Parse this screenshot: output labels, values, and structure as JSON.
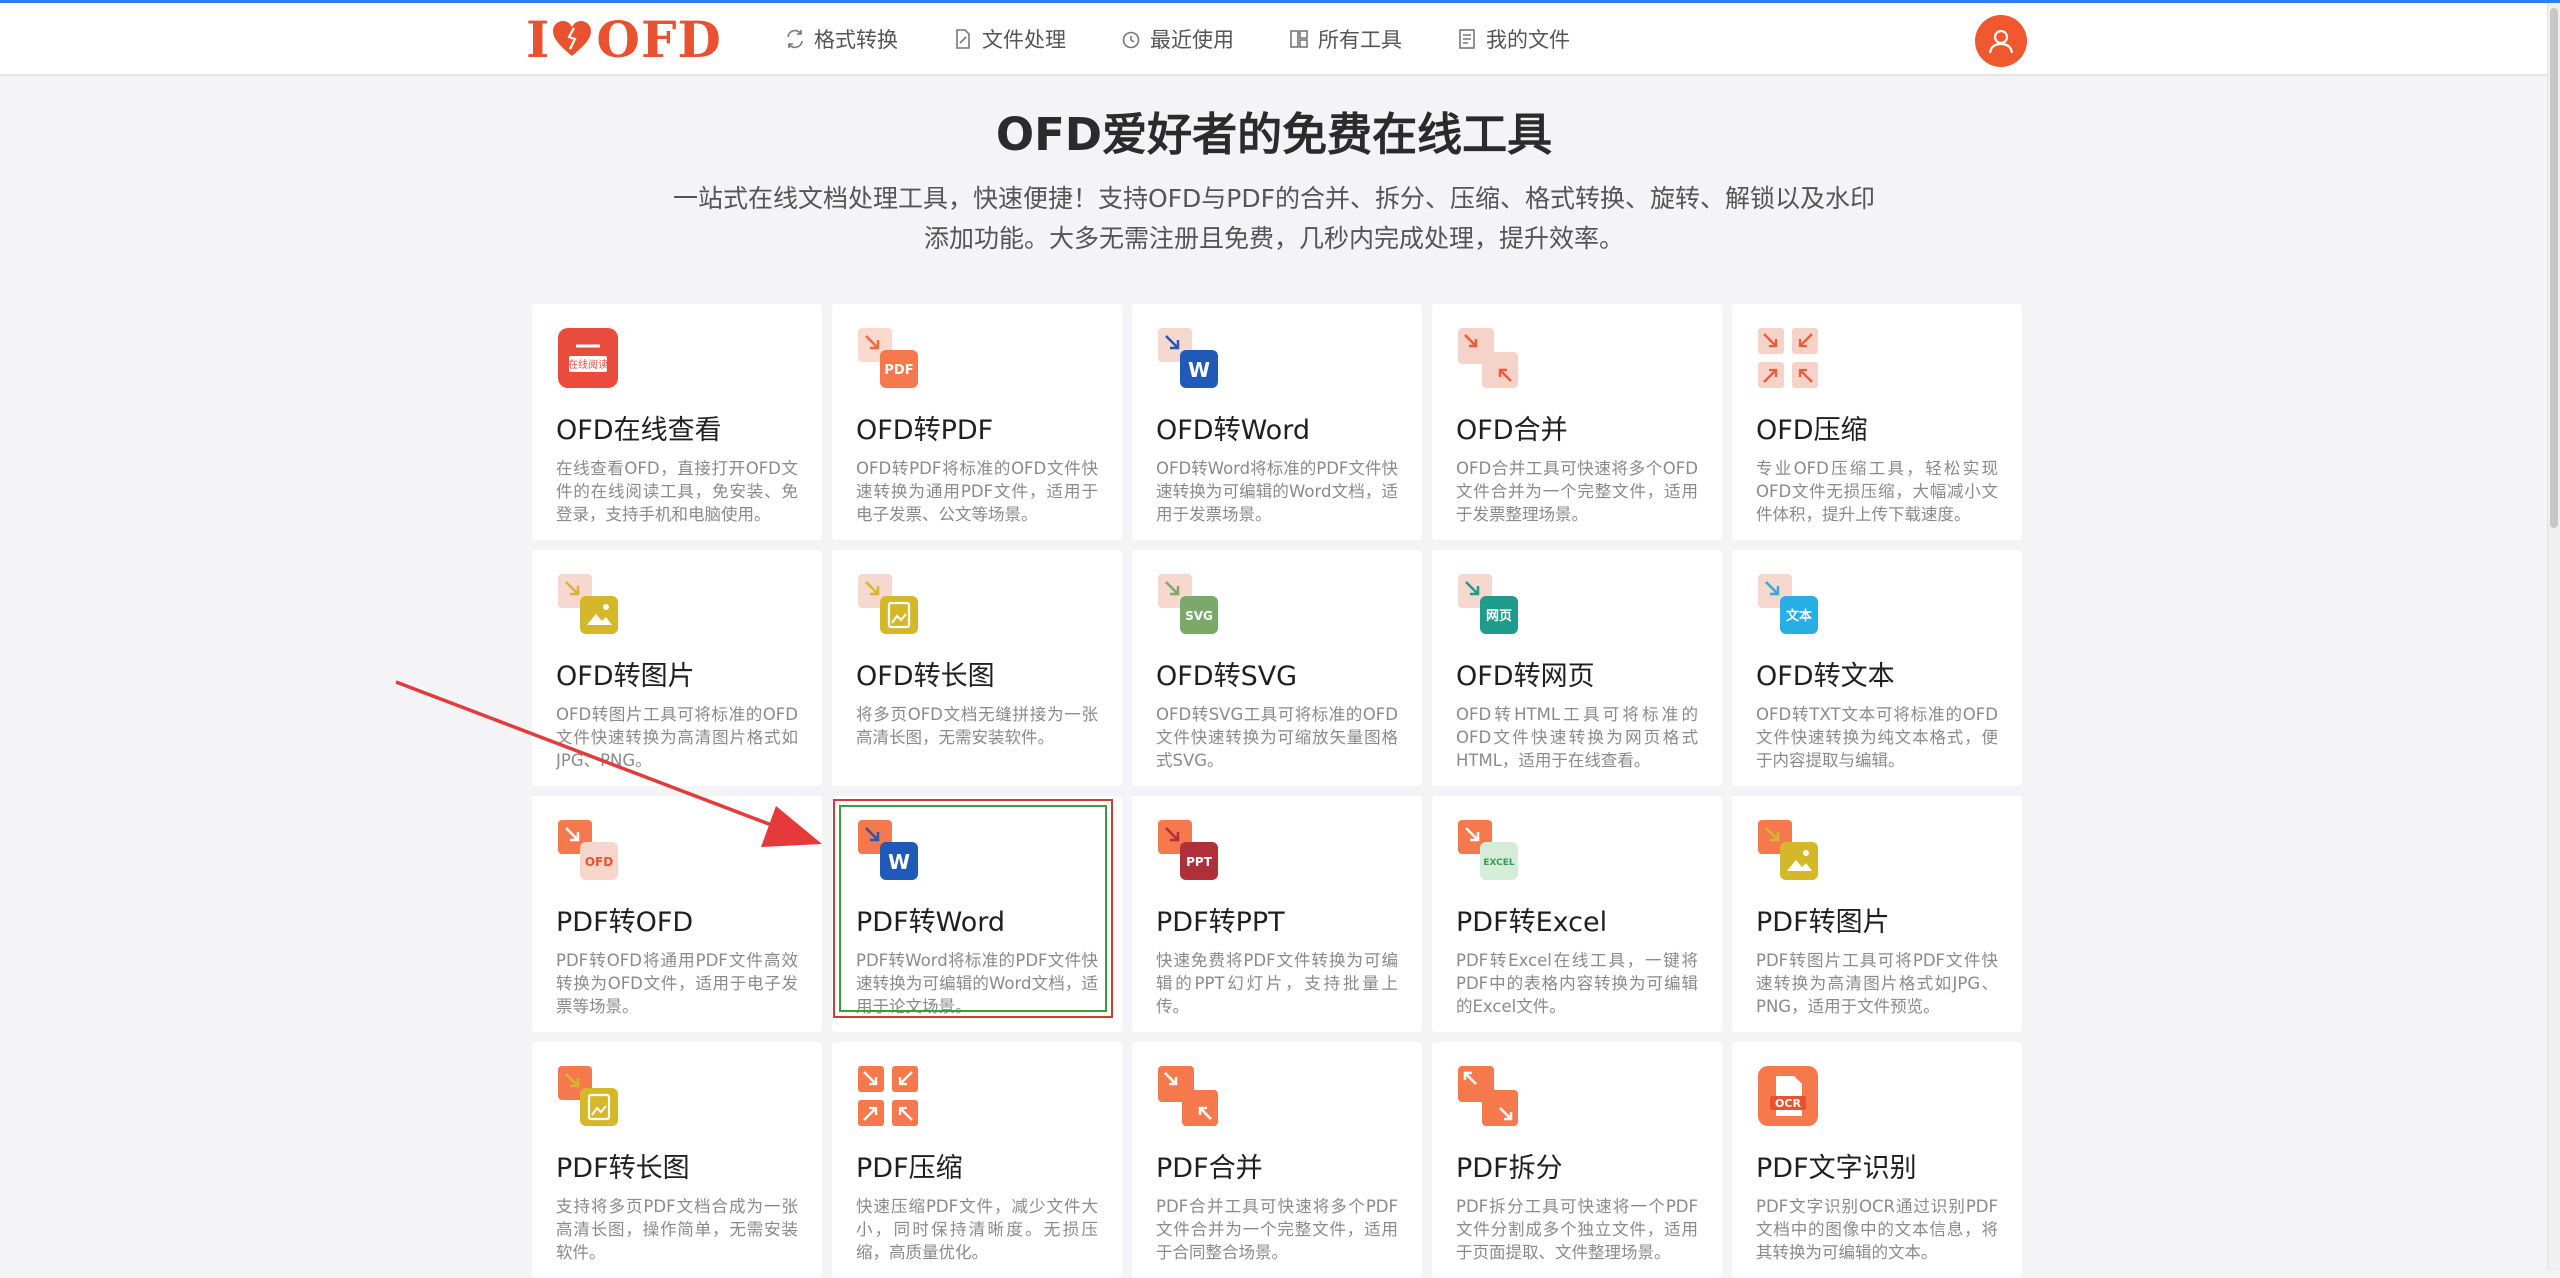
{
  "header": {
    "logo_text_left": "I",
    "logo_text_right": "OFD",
    "nav": [
      {
        "label": "格式转换",
        "icon": "convert-icon"
      },
      {
        "label": "文件处理",
        "icon": "file-edit-icon"
      },
      {
        "label": "最近使用",
        "icon": "clock-icon"
      },
      {
        "label": "所有工具",
        "icon": "tools-icon"
      },
      {
        "label": "我的文件",
        "icon": "my-files-icon"
      }
    ],
    "avatar_icon": "user-icon"
  },
  "hero": {
    "title": "OFD爱好者的免费在线工具",
    "desc_line1": "一站式在线文档处理工具，快速便捷！支持OFD与PDF的合并、拆分、压缩、格式转换、旋转、解锁以及水印",
    "desc_line2": "添加功能。大多无需注册且免费，几秒内完成处理，提升效率。"
  },
  "tools": [
    {
      "title": "OFD在线查看",
      "desc": "在线查看OFD，直接打开OFD文件的在线阅读工具，免安装、免登录，支持手机和电脑使用。",
      "icon": "ofd-viewer-icon"
    },
    {
      "title": "OFD转PDF",
      "desc": "OFD转PDF将标准的OFD文件快速转换为通用PDF文件，适用于电子发票、公文等场景。",
      "icon": "ofd-to-pdf-icon"
    },
    {
      "title": "OFD转Word",
      "desc": "OFD转Word将标准的PDF文件快速转换为可编辑的Word文档，适用于发票场景。",
      "icon": "ofd-to-word-icon"
    },
    {
      "title": "OFD合并",
      "desc": "OFD合并工具可快速将多个OFD文件合并为一个完整文件，适用于发票整理场景。",
      "icon": "ofd-merge-icon"
    },
    {
      "title": "OFD压缩",
      "desc": "专业OFD压缩工具，轻松实现OFD文件无损压缩，大幅减小文件体积，提升上传下载速度。",
      "icon": "ofd-compress-icon"
    },
    {
      "title": "OFD转图片",
      "desc": "OFD转图片工具可将标准的OFD文件快速转换为高清图片格式如JPG、PNG。",
      "icon": "ofd-to-image-icon"
    },
    {
      "title": "OFD转长图",
      "desc": "将多页OFD文档无缝拼接为一张高清长图，无需安装软件。",
      "icon": "ofd-to-long-image-icon"
    },
    {
      "title": "OFD转SVG",
      "desc": "OFD转SVG工具可将标准的OFD文件快速转换为可缩放矢量图格式SVG。",
      "icon": "ofd-to-svg-icon"
    },
    {
      "title": "OFD转网页",
      "desc": "OFD转HTML工具可将标准的OFD文件快速转换为网页格式HTML，适用于在线查看。",
      "icon": "ofd-to-html-icon"
    },
    {
      "title": "OFD转文本",
      "desc": "OFD转TXT文本可将标准的OFD文件快速转换为纯文本格式，便于内容提取与编辑。",
      "icon": "ofd-to-text-icon"
    },
    {
      "title": "PDF转OFD",
      "desc": "PDF转OFD将通用PDF文件高效转换为OFD文件，适用于电子发票等场景。",
      "icon": "pdf-to-ofd-icon"
    },
    {
      "title": "PDF转Word",
      "desc": "PDF转Word将标准的PDF文件快速转换为可编辑的Word文档，适用于论文场景。",
      "icon": "pdf-to-word-icon"
    },
    {
      "title": "PDF转PPT",
      "desc": "快速免费将PDF文件转换为可编辑的PPT幻灯片，支持批量上传。",
      "icon": "pdf-to-ppt-icon"
    },
    {
      "title": "PDF转Excel",
      "desc": "PDF转Excel在线工具，一键将PDF中的表格内容转换为可编辑的Excel文件。",
      "icon": "pdf-to-excel-icon"
    },
    {
      "title": "PDF转图片",
      "desc": "PDF转图片工具可将PDF文件快速转换为高清图片格式如JPG、PNG，适用于文件预览。",
      "icon": "pdf-to-image-icon"
    },
    {
      "title": "PDF转长图",
      "desc": "支持将多页PDF文档合成为一张高清长图，操作简单，无需安装软件。",
      "icon": "pdf-to-long-image-icon"
    },
    {
      "title": "PDF压缩",
      "desc": "快速压缩PDF文件，减少文件大小，同时保持清晰度。无损压缩，高质量优化。",
      "icon": "pdf-compress-icon"
    },
    {
      "title": "PDF合并",
      "desc": "PDF合并工具可快速将多个PDF文件合并为一个完整文件，适用于合同整合场景。",
      "icon": "pdf-merge-icon"
    },
    {
      "title": "PDF拆分",
      "desc": "PDF拆分工具可快速将一个PDF文件分割成多个独立文件，适用于页面提取、文件整理场景。",
      "icon": "pdf-split-icon"
    },
    {
      "title": "PDF文字识别",
      "desc": "PDF文字识别OCR通过识别PDF文档中的图像中的文本信息，将其转换为可编辑的文本。",
      "icon": "pdf-ocr-icon"
    }
  ],
  "icon_labels": {
    "viewer": "在线阅读",
    "pdf": "PDF",
    "word": "W",
    "svg": "SVG",
    "html": "网页",
    "text": "文本",
    "ofd": "OFD",
    "ppt": "PPT",
    "excel": "EXCEL",
    "ocr": "OCR"
  },
  "colors": {
    "brand": "#e9522f",
    "accent_blue": "#2f7cf5",
    "word_blue": "#2059b8",
    "ppt_red": "#b0303a",
    "excel_green": "#3a9a52",
    "image_yellow": "#d4b82a",
    "svg_green": "#7aa96a",
    "html_teal": "#1f9b8c",
    "text_cyan": "#27aee4",
    "highlight_red": "#d23a3a",
    "highlight_green": "#3f9a3f",
    "arrow_red": "#e53a3a"
  }
}
